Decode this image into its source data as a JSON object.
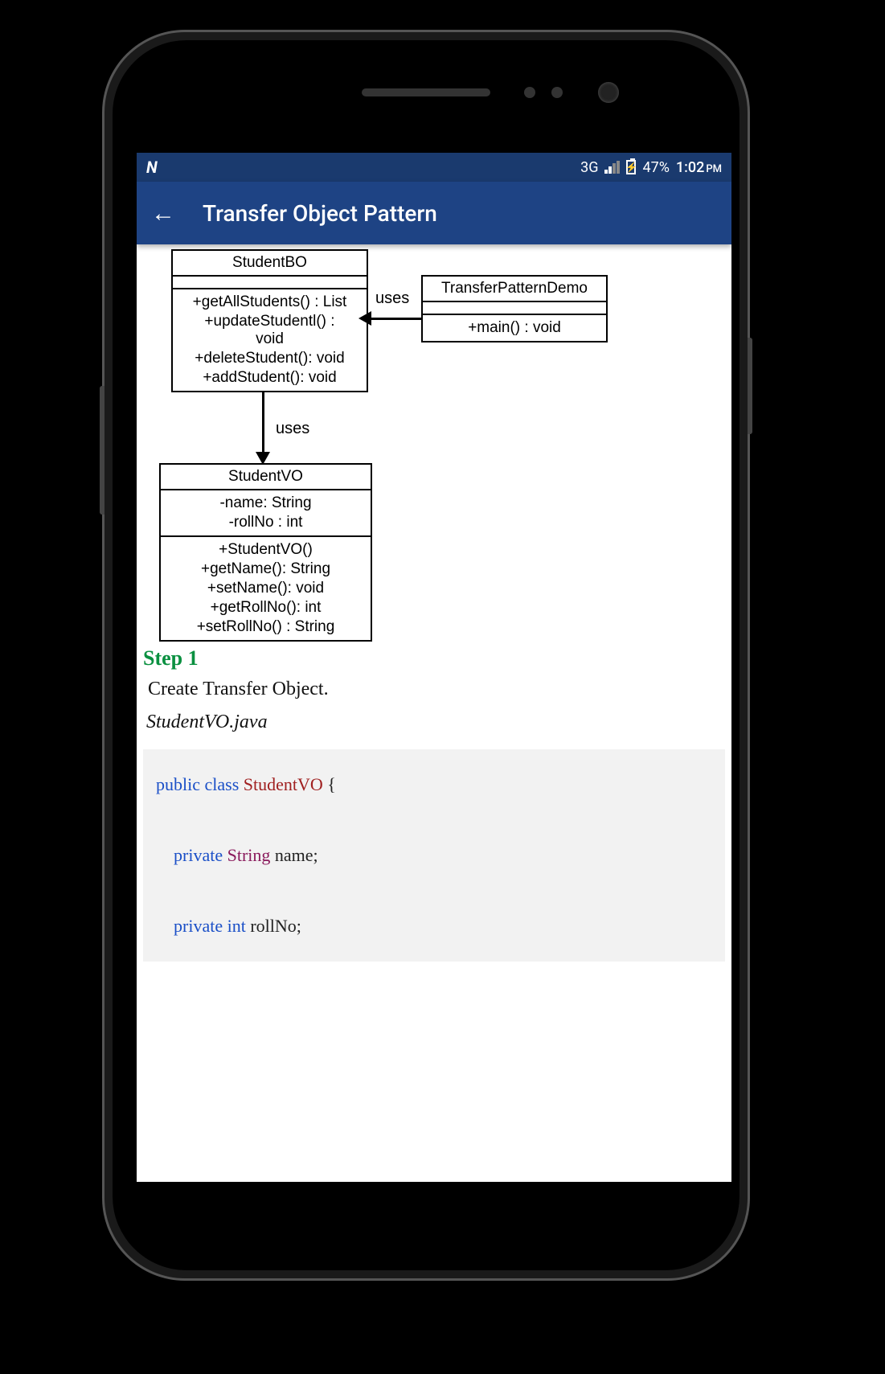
{
  "status_bar": {
    "left_icon": "N",
    "network": "3G",
    "battery_percent": "47%",
    "time": "1:02",
    "time_suffix": "PM"
  },
  "app_bar": {
    "title": "Transfer Object Pattern"
  },
  "diagram": {
    "boxes": {
      "bo": {
        "name": "StudentBO",
        "methods": [
          "+getAllStudents()  : List",
          "+updateStudentl()  : void",
          "+deleteStudent(): void",
          "+addStudent(): void"
        ]
      },
      "demo": {
        "name": "TransferPatternDemo",
        "methods": [
          "+main()  : void"
        ]
      },
      "vo": {
        "name": "StudentVO",
        "attributes": [
          "-name: String",
          "-rollNo  : int"
        ],
        "methods": [
          "+StudentVO()",
          "+getName(): String",
          "+setName(): void",
          "+getRollNo(): int",
          "+setRollNo()  : String"
        ]
      }
    },
    "labels": {
      "uses1": "uses",
      "uses2": "uses"
    }
  },
  "step": {
    "heading": "Step 1",
    "description": "Create Transfer Object.",
    "filename": "StudentVO.java"
  },
  "code": {
    "kw": {
      "public": "public",
      "class": "class",
      "private": "private",
      "int": "int"
    },
    "types": {
      "String": "String"
    },
    "classname": "StudentVO",
    "brace_open": " {",
    "semicolon": ";",
    "vars": {
      "name": " name",
      "rollNo": " rollNo"
    }
  }
}
